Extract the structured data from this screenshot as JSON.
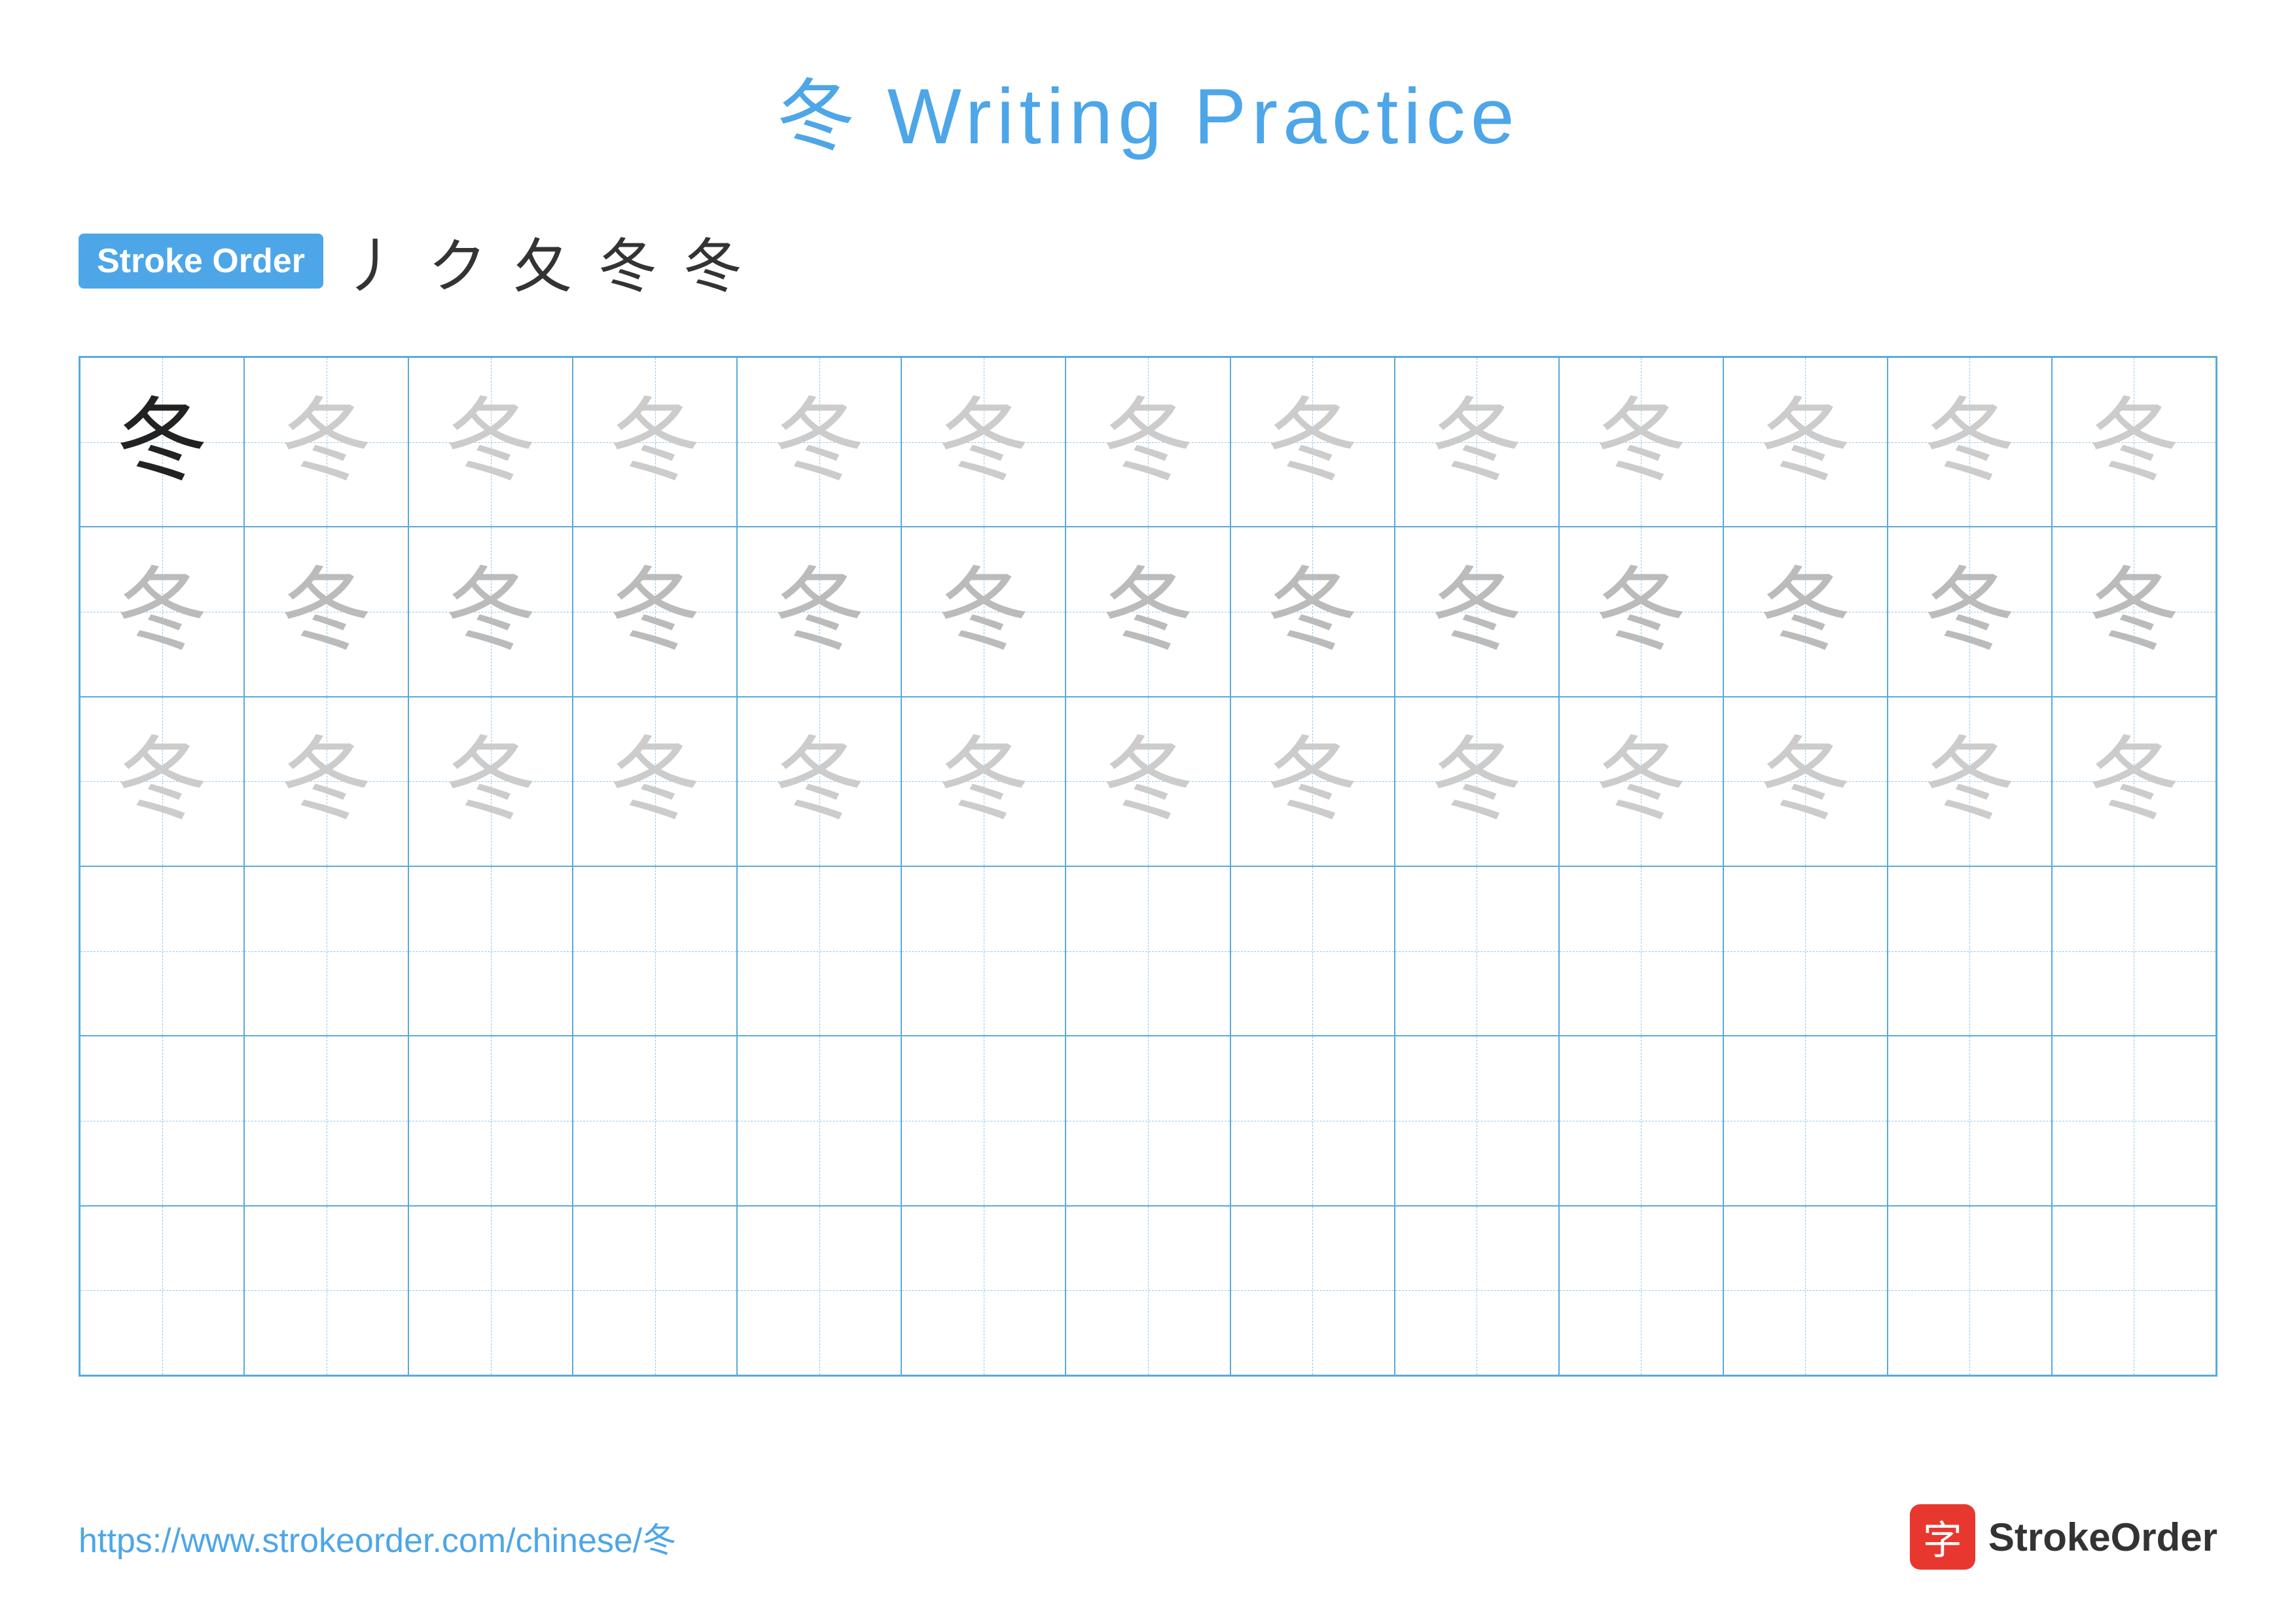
{
  "title": {
    "char": "冬",
    "text": " Writing Practice",
    "full": "冬 Writing Practice"
  },
  "stroke_order": {
    "badge_label": "Stroke Order",
    "strokes": [
      "丿",
      "ク",
      "夂",
      "冬",
      "冬"
    ]
  },
  "grid": {
    "cols": 13,
    "rows": 6,
    "char": "冬",
    "row1_first_style": "dark",
    "row1_rest_style": "light",
    "row2_style": "medium",
    "row3_style": "light"
  },
  "footer": {
    "url": "https://www.strokeorder.com/chinese/冬",
    "logo_char": "字",
    "logo_name": "StrokeOrder"
  }
}
